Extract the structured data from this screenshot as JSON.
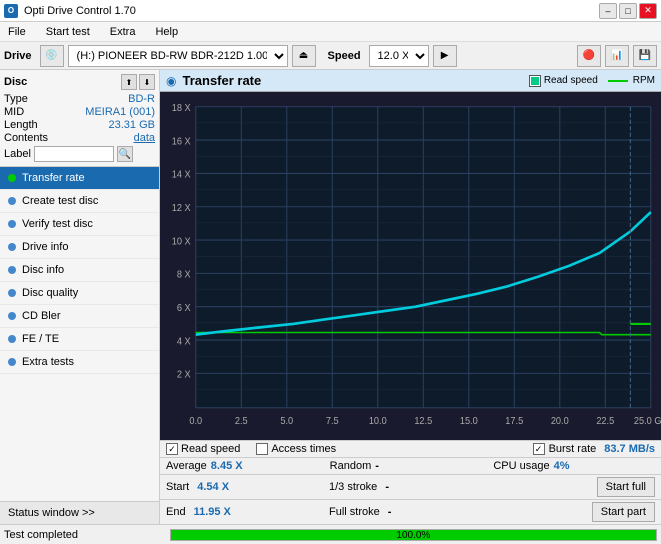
{
  "window": {
    "title": "Opti Drive Control 1.70",
    "icon": "ODC"
  },
  "titlebar": {
    "minimize": "–",
    "maximize": "□",
    "close": "✕"
  },
  "menubar": {
    "items": [
      "File",
      "Start test",
      "Extra",
      "Help"
    ]
  },
  "drive_toolbar": {
    "drive_label": "Drive",
    "drive_value": "(H:)  PIONEER BD-RW  BDR-212D 1.00",
    "speed_label": "Speed",
    "speed_value": "12.0 X ∨"
  },
  "disc": {
    "title": "Disc",
    "type_label": "Type",
    "type_value": "BD-R",
    "mid_label": "MID",
    "mid_value": "MEIRA1 (001)",
    "length_label": "Length",
    "length_value": "23.31 GB",
    "contents_label": "Contents",
    "contents_value": "data",
    "label_label": "Label",
    "label_placeholder": ""
  },
  "nav": {
    "items": [
      {
        "id": "transfer-rate",
        "label": "Transfer rate",
        "active": true
      },
      {
        "id": "create-test-disc",
        "label": "Create test disc",
        "active": false
      },
      {
        "id": "verify-test-disc",
        "label": "Verify test disc",
        "active": false
      },
      {
        "id": "drive-info",
        "label": "Drive info",
        "active": false
      },
      {
        "id": "disc-info",
        "label": "Disc info",
        "active": false
      },
      {
        "id": "disc-quality",
        "label": "Disc quality",
        "active": false
      },
      {
        "id": "cd-bler",
        "label": "CD Bler",
        "active": false
      },
      {
        "id": "fe-te",
        "label": "FE / TE",
        "active": false
      },
      {
        "id": "extra-tests",
        "label": "Extra tests",
        "active": false
      }
    ],
    "status_window": "Status window >>"
  },
  "chart": {
    "title": "Transfer rate",
    "icon": "◉",
    "legend": {
      "read_speed_label": "Read speed",
      "rpm_label": "RPM"
    },
    "y_axis": [
      "18 X",
      "16 X",
      "14 X",
      "12 X",
      "10 X",
      "8 X",
      "6 X",
      "4 X",
      "2 X"
    ],
    "x_axis": [
      "0.0",
      "2.5",
      "5.0",
      "7.5",
      "10.0",
      "12.5",
      "15.0",
      "17.5",
      "20.0",
      "22.5",
      "25.0 GB"
    ]
  },
  "checkboxes": {
    "read_speed": {
      "label": "Read speed",
      "checked": true
    },
    "access_times": {
      "label": "Access times",
      "checked": false
    },
    "burst_rate": {
      "label": "Burst rate",
      "checked": true
    },
    "burst_rate_value": "83.7 MB/s"
  },
  "stats": {
    "average_label": "Average",
    "average_value": "8.45 X",
    "random_label": "Random",
    "random_value": "-",
    "cpu_label": "CPU usage",
    "cpu_value": "4%",
    "start_label": "Start",
    "start_value": "4.54 X",
    "stroke_1_3_label": "1/3 stroke",
    "stroke_1_3_value": "-",
    "end_label": "End",
    "end_value": "11.95 X",
    "full_stroke_label": "Full stroke",
    "full_stroke_value": "-"
  },
  "action_buttons": {
    "start_full": "Start full",
    "start_part": "Start part"
  },
  "status_bar": {
    "text": "Test completed",
    "progress": 100,
    "progress_label": "100.0%"
  }
}
